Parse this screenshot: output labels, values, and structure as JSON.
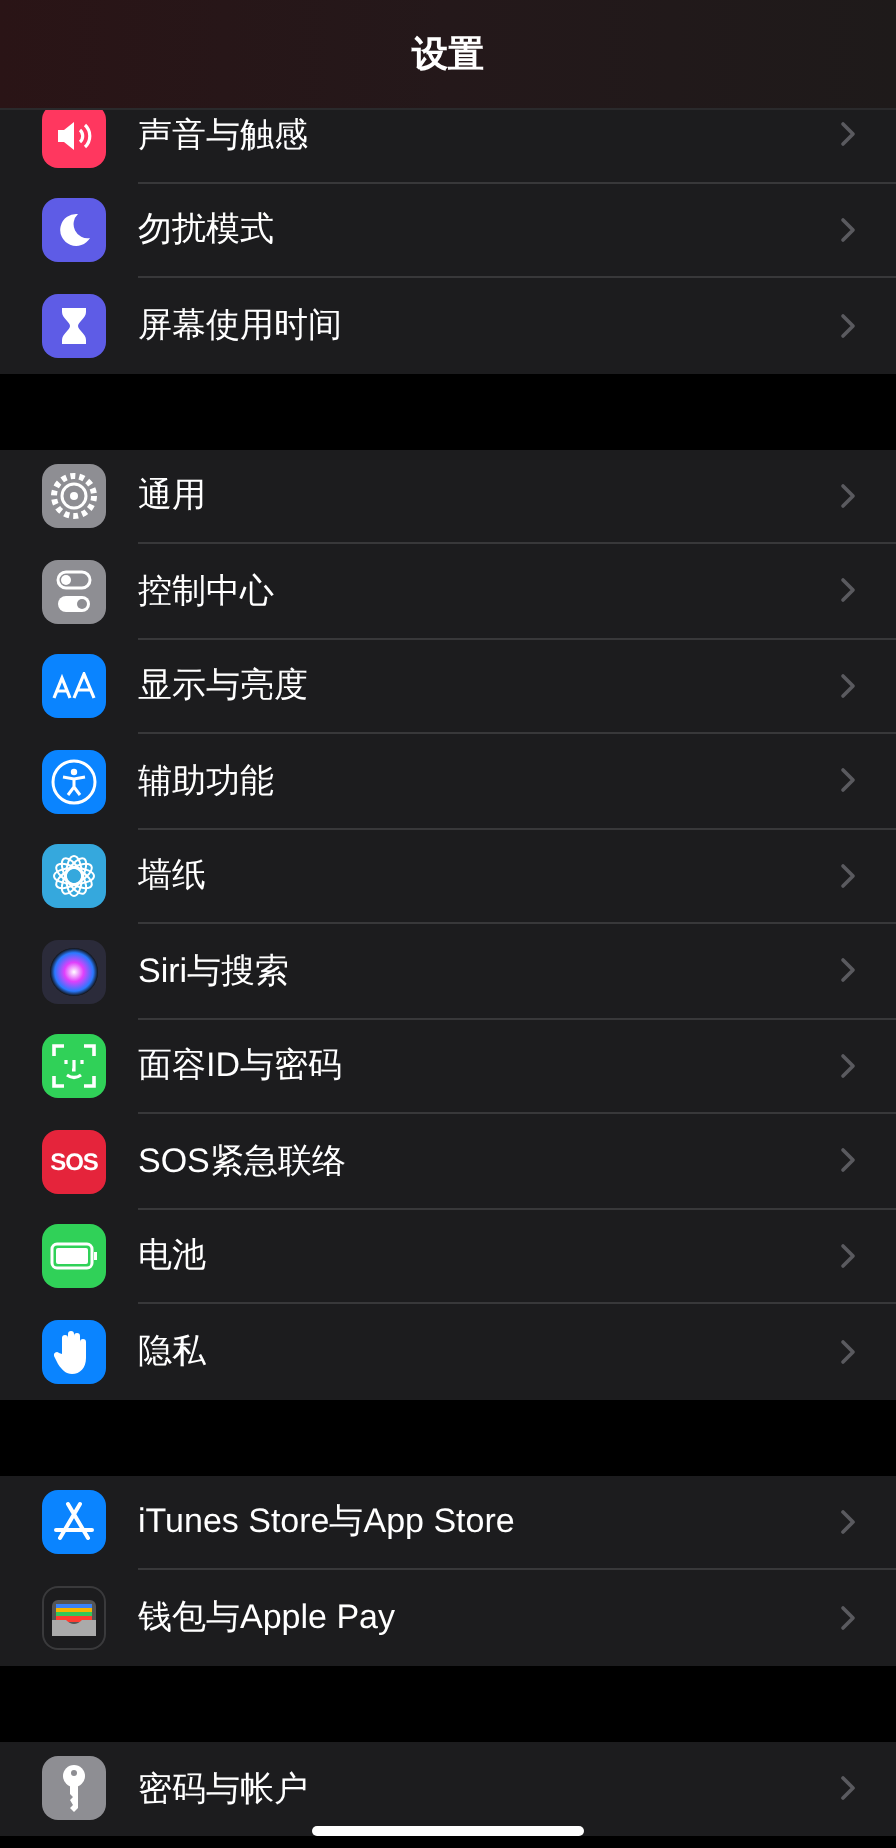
{
  "title": "设置",
  "groups": [
    {
      "items": [
        {
          "label": "声音与触感",
          "color": "#ff375f"
        },
        {
          "label": "勿扰模式",
          "color": "#5e5ce6"
        },
        {
          "label": "屏幕使用时间",
          "color": "#5e5ce6"
        }
      ]
    },
    {
      "items": [
        {
          "label": "通用",
          "color": "#8e8e93"
        },
        {
          "label": "控制中心",
          "color": "#8e8e93"
        },
        {
          "label": "显示与亮度",
          "color": "#0a84ff"
        },
        {
          "label": "辅助功能",
          "color": "#0a84ff"
        },
        {
          "label": "墙纸",
          "color": "#35a8dd"
        },
        {
          "label": "Siri与搜索",
          "color": "#2b2b3a"
        },
        {
          "label": "面容ID与密码",
          "color": "#30d158"
        },
        {
          "label": "SOS紧急联络",
          "color": "#e5243b",
          "badge_text": "SOS"
        },
        {
          "label": "电池",
          "color": "#30d158"
        },
        {
          "label": "隐私",
          "color": "#0a84ff"
        }
      ]
    },
    {
      "items": [
        {
          "label": "iTunes Store与App Store",
          "color": "#0a84ff"
        },
        {
          "label": "钱包与Apple Pay",
          "color": "#1c1c1e"
        }
      ]
    },
    {
      "items": [
        {
          "label": "密码与帐户",
          "color": "#8e8e93"
        }
      ]
    }
  ]
}
